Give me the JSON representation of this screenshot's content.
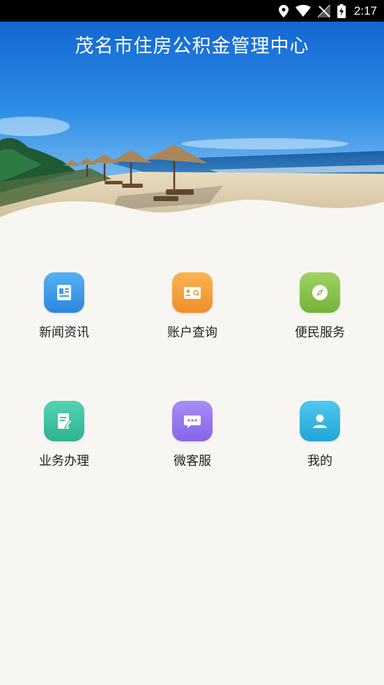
{
  "status_bar": {
    "time": "2:17",
    "icons": [
      "location-icon",
      "wifi-icon",
      "no-signal-icon",
      "battery-charging-icon"
    ]
  },
  "header": {
    "title": "茂名市住房公积金管理中心"
  },
  "colors": {
    "news": "#3d9be8",
    "account": "#f6a03c",
    "services": "#8ac34f",
    "business": "#3fc3a6",
    "chat": "#9a7cf0",
    "mine": "#35b8e2"
  },
  "menu": {
    "items": [
      {
        "label": "新闻资讯",
        "icon": "news-icon"
      },
      {
        "label": "账户查询",
        "icon": "account-query-icon"
      },
      {
        "label": "便民服务",
        "icon": "compass-icon"
      },
      {
        "label": "业务办理",
        "icon": "document-edit-icon"
      },
      {
        "label": "微客服",
        "icon": "chat-icon"
      },
      {
        "label": "我的",
        "icon": "user-icon"
      }
    ]
  }
}
